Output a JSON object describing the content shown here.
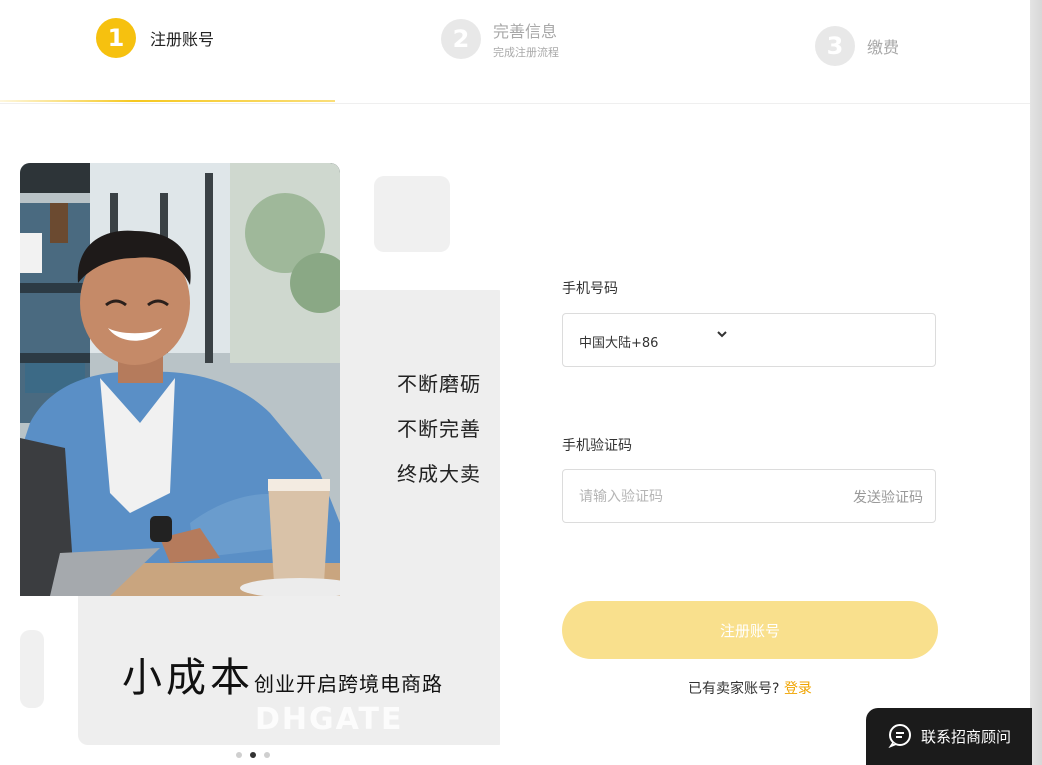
{
  "steps": [
    {
      "number": "1",
      "title": "注册账号",
      "subtitle": ""
    },
    {
      "number": "2",
      "title": "完善信息",
      "subtitle": "完成注册流程"
    },
    {
      "number": "3",
      "title": "缴费",
      "subtitle": ""
    }
  ],
  "promo": {
    "slogan_lines": [
      "不断磨砺",
      "不断完善",
      "终成大卖"
    ],
    "tagline_big": "小成本",
    "tagline_small": "创业开启跨境电商路",
    "watermark": "DHGATE",
    "carousel_active_index": 1
  },
  "form": {
    "phone_label": "手机号码",
    "country_value": "中国大陆+86",
    "code_label": "手机验证码",
    "code_placeholder": "请输入验证码",
    "send_code": "发送验证码",
    "submit_label": "注册账号",
    "has_account": "已有卖家账号?",
    "login_link": "登录"
  },
  "consult_button": "联系招商顾问",
  "colors": {
    "accent": "#f6c10f",
    "submit_bg": "#f9e08d",
    "link": "#f0a400"
  }
}
